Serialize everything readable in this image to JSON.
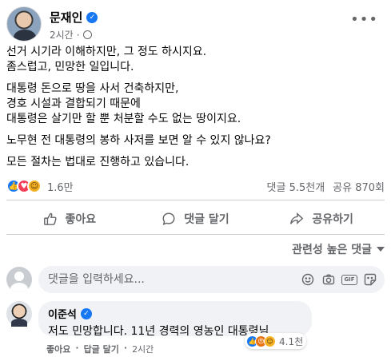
{
  "post": {
    "author": "문재인",
    "time": "2시간",
    "paragraphs": [
      "선거 시기라 이해하지만, 그 정도 하시지요.\n좀스럽고, 민망한 일입니다.",
      "대통령 돈으로 땅을 사서 건축하지만,\n경호 시설과 결합되기 때문에\n대통령은 살기만 할 뿐 처분할 수도 없는 땅이지요.",
      "노무현 전 대통령의 봉하 사저를 보면 알 수 있지 않나요?",
      "모든 절차는 법대로 진행하고 있습니다."
    ]
  },
  "reactions": {
    "icons": [
      "like-icon",
      "love-icon",
      "haha-icon"
    ],
    "count": "1.6만",
    "comments": "댓글 5.5천개",
    "shares": "공유 870회"
  },
  "actions": {
    "like": "좋아요",
    "comment": "댓글 달기",
    "share": "공유하기"
  },
  "sort_label": "관련성 높은 댓글",
  "composer": {
    "placeholder": "댓글을 입력하세요..."
  },
  "comment": {
    "author": "이준석",
    "text": "저도 민망합니다. 11년 경력의 영농인 대통령님.",
    "reaction_count": "4.1천",
    "like": "좋아요",
    "reply": "답글 달기",
    "time": "2시간"
  },
  "colors": {
    "accent": "#1877f2",
    "love": "#f33e58",
    "haha": "#f7b125",
    "angry": "#e9710f",
    "muted": "#65676b"
  }
}
